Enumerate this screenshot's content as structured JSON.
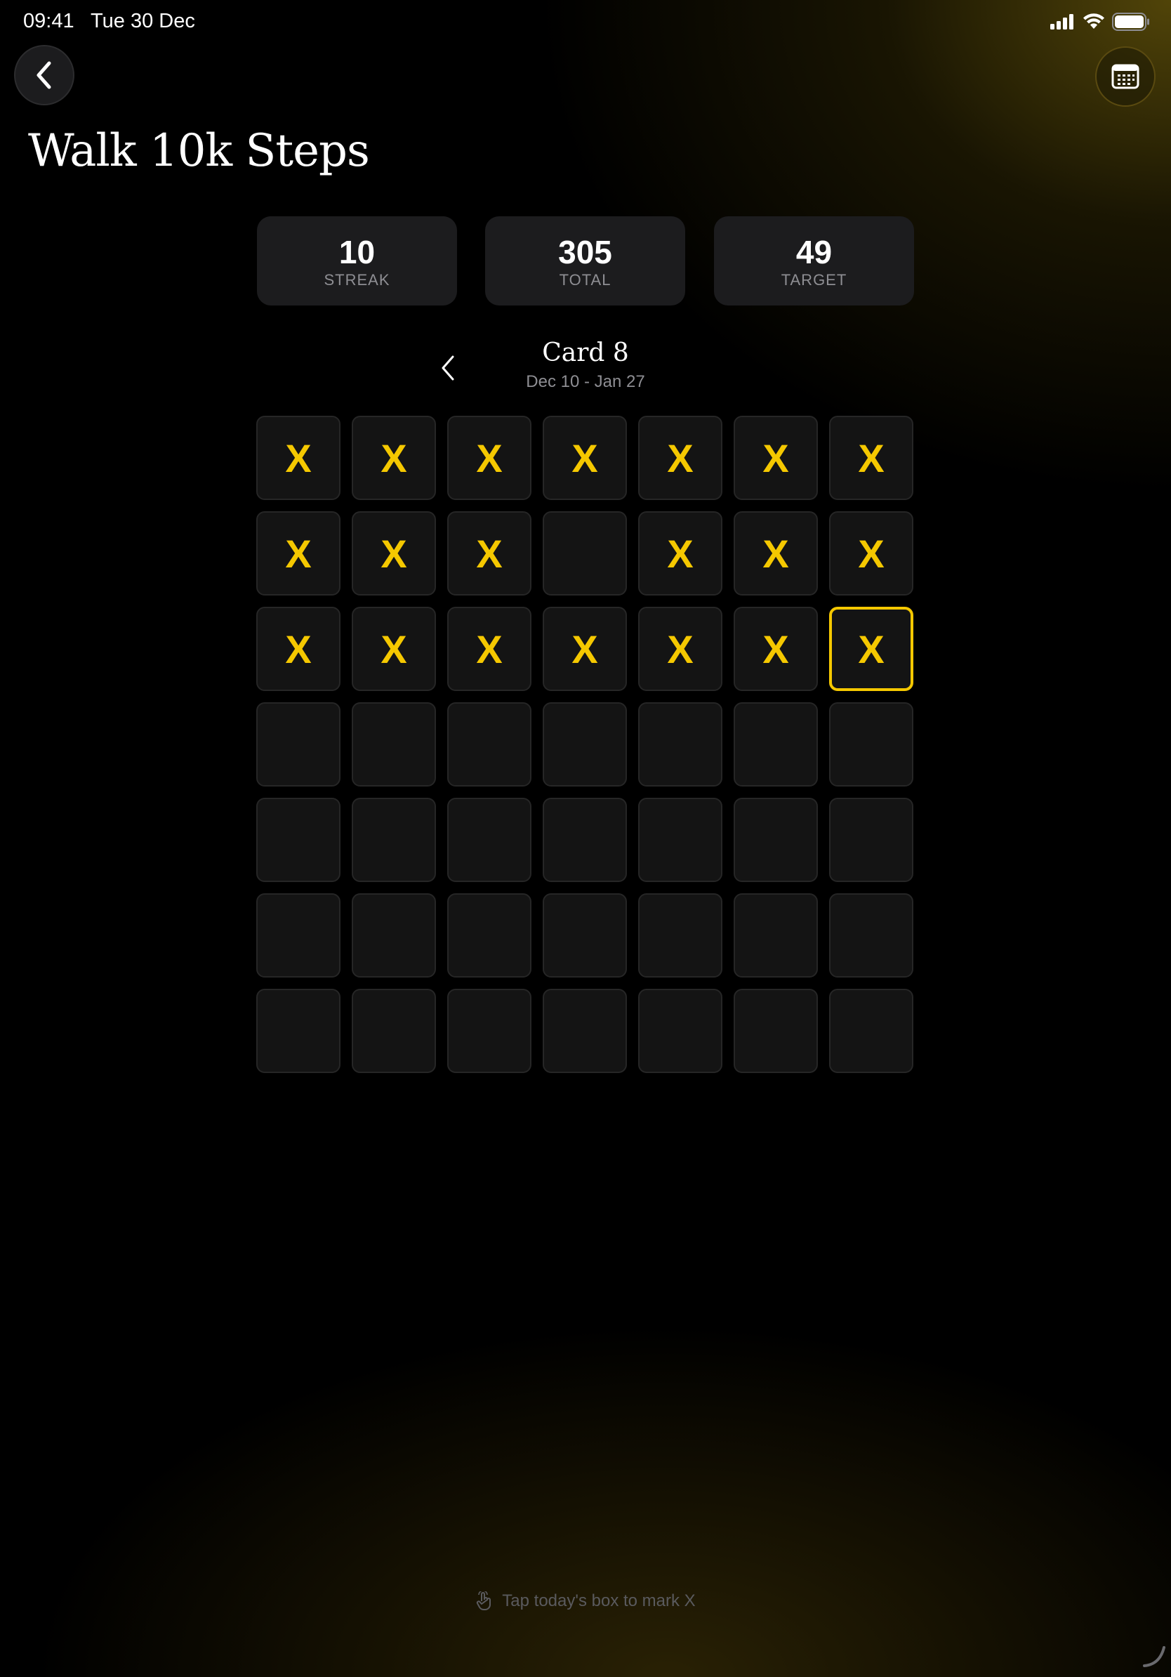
{
  "status_bar": {
    "time": "09:41",
    "date": "Tue 30 Dec",
    "icons": [
      "cellular-signal-icon",
      "wifi-icon",
      "battery-icon"
    ]
  },
  "header": {
    "back_icon": "chevron-left-icon",
    "calendar_icon": "calendar-icon",
    "title": "Walk 10k Steps"
  },
  "stats": [
    {
      "value": "10",
      "label": "STREAK"
    },
    {
      "value": "305",
      "label": "TOTAL"
    },
    {
      "value": "49",
      "label": "TARGET"
    }
  ],
  "card": {
    "title": "Card 8",
    "range": "Dec 10 - Jan 27",
    "prev_icon": "chevron-left-icon"
  },
  "grid": {
    "columns": 7,
    "rows": 7,
    "mark": "X",
    "today_index": 20,
    "cells": [
      "X",
      "X",
      "X",
      "X",
      "X",
      "X",
      "X",
      "X",
      "X",
      "X",
      "",
      "X",
      "X",
      "X",
      "X",
      "X",
      "X",
      "X",
      "X",
      "X",
      "X",
      "",
      "",
      "",
      "",
      "",
      "",
      "",
      "",
      "",
      "",
      "",
      "",
      "",
      "",
      "",
      "",
      "",
      "",
      "",
      "",
      "",
      "",
      "",
      "",
      "",
      "",
      "",
      ""
    ]
  },
  "hint": {
    "icon": "tap-hand-icon",
    "text": "Tap today's box to mark X"
  },
  "colors": {
    "accent": "#f5c800",
    "cell_bg": "#141414",
    "card_bg": "#1c1c1e",
    "muted_text": "#8e8e93"
  }
}
